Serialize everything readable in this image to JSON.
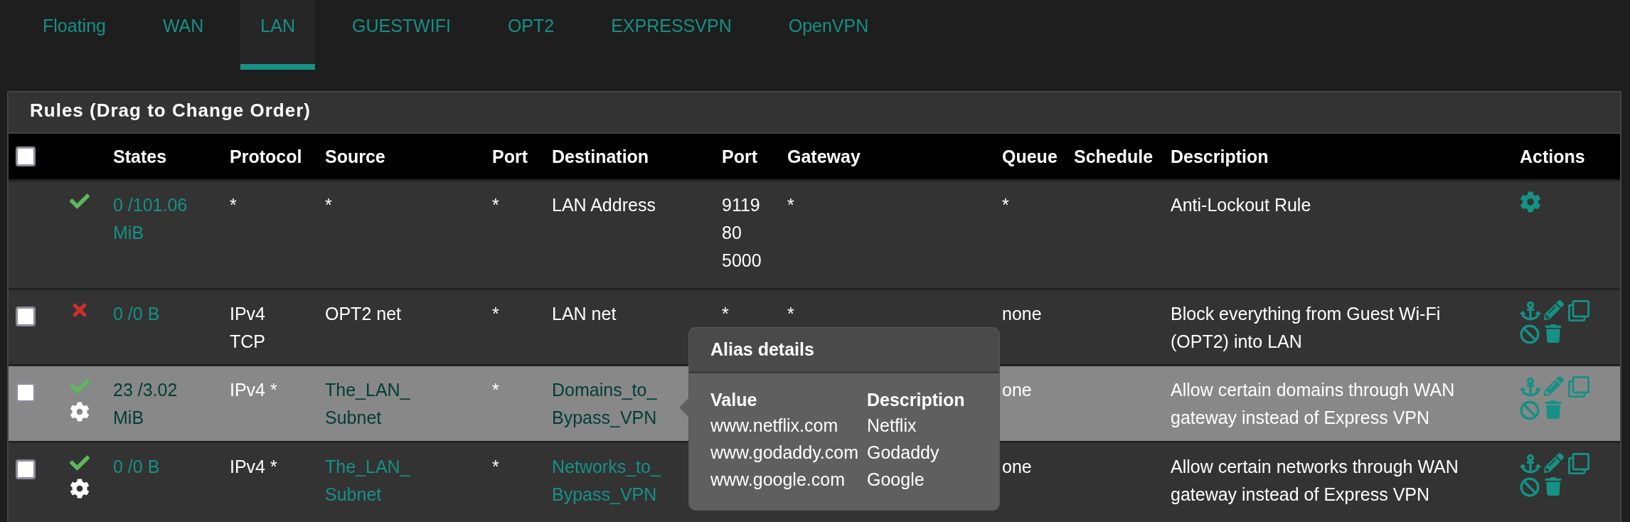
{
  "tabs": [
    {
      "label": "Floating",
      "selected": false
    },
    {
      "label": "WAN",
      "selected": false
    },
    {
      "label": "LAN",
      "selected": true
    },
    {
      "label": "GUESTWIFI",
      "selected": false
    },
    {
      "label": "OPT2",
      "selected": false
    },
    {
      "label": "EXPRESSVPN",
      "selected": false
    },
    {
      "label": "OpenVPN",
      "selected": false
    }
  ],
  "panel": {
    "title": "Rules (Drag to Change Order)",
    "select_all_checked": false,
    "columns": [
      "States",
      "Protocol",
      "Source",
      "Port",
      "Destination",
      "Port",
      "Gateway",
      "Queue",
      "Schedule",
      "Description",
      "Actions"
    ],
    "rows": [
      {
        "kind": "locked",
        "highlighted": false,
        "blocked": false,
        "advanced": false,
        "states": "0 /101.06\nMiB",
        "protocol": "*",
        "source": "*",
        "source_alias": false,
        "source_port": "*",
        "destination": "LAN Address",
        "destination_alias": false,
        "destination_port": "9119\n80\n5000",
        "gateway": "*",
        "queue": "*",
        "schedule": "",
        "description": "Anti-Lockout Rule"
      },
      {
        "kind": "rule",
        "checked": false,
        "highlighted": false,
        "blocked": true,
        "advanced": false,
        "states": "0 /0 B",
        "protocol": "IPv4\nTCP",
        "source": "OPT2 net",
        "source_alias": false,
        "source_port": "*",
        "destination": "LAN net",
        "destination_alias": false,
        "destination_port": "*",
        "gateway": "*",
        "queue": "none",
        "schedule": "",
        "description": "Block everything from Guest Wi-Fi\n(OPT2) into LAN"
      },
      {
        "kind": "rule",
        "checked": false,
        "highlighted": true,
        "blocked": false,
        "advanced": true,
        "states": "23 /3.02\nMiB",
        "protocol": "IPv4 *",
        "source": "The_LAN_\nSubnet",
        "source_alias": true,
        "source_port": "*",
        "destination": "Domains_to_\nBypass_VPN",
        "destination_alias": true,
        "destination_port": "",
        "gateway": "",
        "queue": "one",
        "schedule": "",
        "description": "Allow certain domains through WAN\ngateway instead of Express VPN"
      },
      {
        "kind": "rule",
        "checked": false,
        "highlighted": false,
        "blocked": false,
        "advanced": true,
        "states": "0 /0 B",
        "protocol": "IPv4 *",
        "source": "The_LAN_\nSubnet",
        "source_alias": true,
        "source_port": "*",
        "destination": "Networks_to_\nBypass_VPN",
        "destination_alias": true,
        "destination_port": "",
        "gateway": "",
        "queue": "one",
        "schedule": "",
        "description": "Allow certain networks through WAN\ngateway instead of Express VPN"
      }
    ]
  },
  "popover": {
    "title": "Alias details",
    "columns": [
      "Value",
      "Description"
    ],
    "rows": [
      [
        "www.netflix.com",
        "Netflix"
      ],
      [
        "www.godaddy.com",
        "Godaddy"
      ],
      [
        "www.google.com",
        "Google"
      ]
    ]
  }
}
